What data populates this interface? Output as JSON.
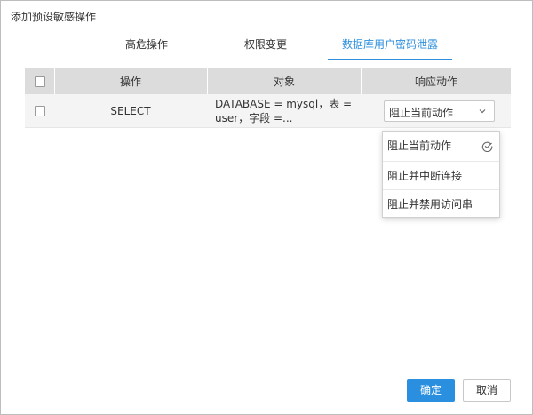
{
  "dialog": {
    "title": "添加预设敏感操作"
  },
  "tabs": [
    {
      "label": "高危操作",
      "active": false
    },
    {
      "label": "权限变更",
      "active": false
    },
    {
      "label": "数据库用户密码泄露",
      "active": true
    }
  ],
  "table": {
    "headers": {
      "operation": "操作",
      "object": "对象",
      "action": "响应动作"
    },
    "rows": [
      {
        "operation": "SELECT",
        "object_line1": "DATABASE = mysql，表 =",
        "object_line2": "user，字段 =...",
        "action": "阻止当前动作"
      }
    ]
  },
  "dropdown": {
    "options": [
      "阻止当前动作",
      "阻止并中断连接",
      "阻止并禁用访问串"
    ],
    "selected": "阻止当前动作"
  },
  "footer": {
    "ok_label": "确定",
    "cancel_label": "取消"
  },
  "colors": {
    "accent": "#2b8fe0",
    "header_bg": "#dcdcdc",
    "row_bg": "#f4f4f4"
  }
}
